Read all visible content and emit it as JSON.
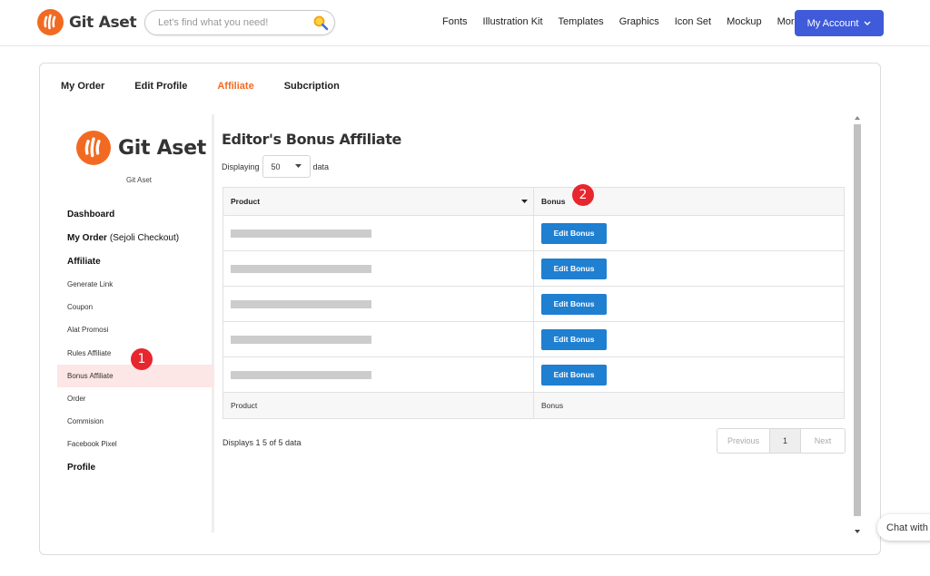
{
  "header": {
    "brand": "Git Aset",
    "search_placeholder": "Let's find what you need!",
    "nav": [
      "Fonts",
      "Illustration Kit",
      "Templates",
      "Graphics",
      "Icon Set",
      "Mockup"
    ],
    "more_label": "More",
    "account_label": "My Account"
  },
  "tabs": [
    "My Order",
    "Edit Profile",
    "Affiliate",
    "Subcription"
  ],
  "sidebar": {
    "brand": "Git Aset",
    "caption": "Git Aset",
    "items": [
      {
        "label": "Dashboard"
      },
      {
        "label": "My Order",
        "sub": "(Sejoli Checkout)"
      },
      {
        "label": "Affiliate"
      },
      {
        "label": "Generate Link"
      },
      {
        "label": "Coupon"
      },
      {
        "label": "Alat Promosi"
      },
      {
        "label": "Rules Affiliate"
      },
      {
        "label": "Bonus Affiliate"
      },
      {
        "label": "Order"
      },
      {
        "label": "Commision"
      },
      {
        "label": "Facebook Pixel"
      },
      {
        "label": "Profile"
      }
    ]
  },
  "content": {
    "title": "Editor's Bonus Affiliate",
    "displaying_label": "Displaying",
    "page_length": "50",
    "data_label": "data",
    "columns": [
      "Product",
      "Bonus"
    ],
    "edit_label": "Edit Bonus",
    "row_count": 5,
    "info": "Displays 1 5 of 5 data",
    "pagination": {
      "prev": "Previous",
      "current": "1",
      "next": "Next"
    }
  },
  "callouts": [
    "1",
    "2"
  ],
  "chat_label": "Chat with",
  "colors": {
    "accent": "#f26a21",
    "primary_button": "#3f5bd9",
    "edit_button": "#1f7fd1",
    "callout": "#e8262e",
    "active_row": "#fde6e6"
  }
}
